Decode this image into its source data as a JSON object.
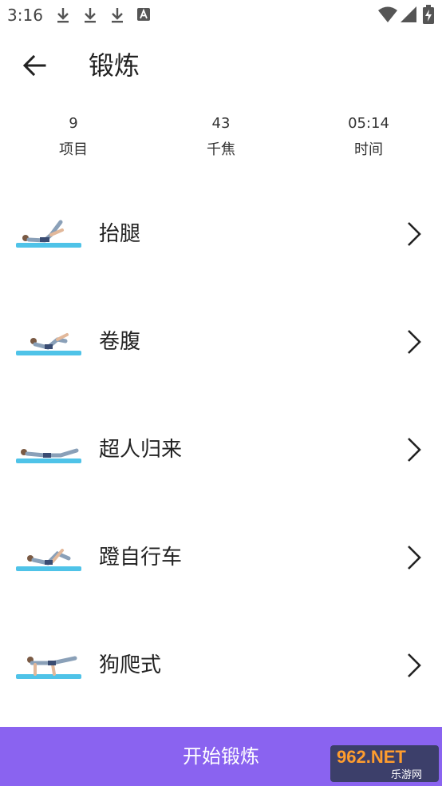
{
  "status_bar": {
    "time": "3:16"
  },
  "header": {
    "title": "锻炼"
  },
  "stats": [
    {
      "value": "9",
      "label": "项目"
    },
    {
      "value": "43",
      "label": "千焦"
    },
    {
      "value": "05:14",
      "label": "时间"
    }
  ],
  "exercises": [
    {
      "name": "抬腿"
    },
    {
      "name": "卷腹"
    },
    {
      "name": "超人归来"
    },
    {
      "name": "蹬自行车"
    },
    {
      "name": "狗爬式"
    }
  ],
  "start_button": {
    "label": "开始锻炼"
  },
  "watermark": {
    "text": "962.NET",
    "sub": "乐游网"
  },
  "colors": {
    "accent": "#8a63f0",
    "mat": "#4fc3e8"
  }
}
